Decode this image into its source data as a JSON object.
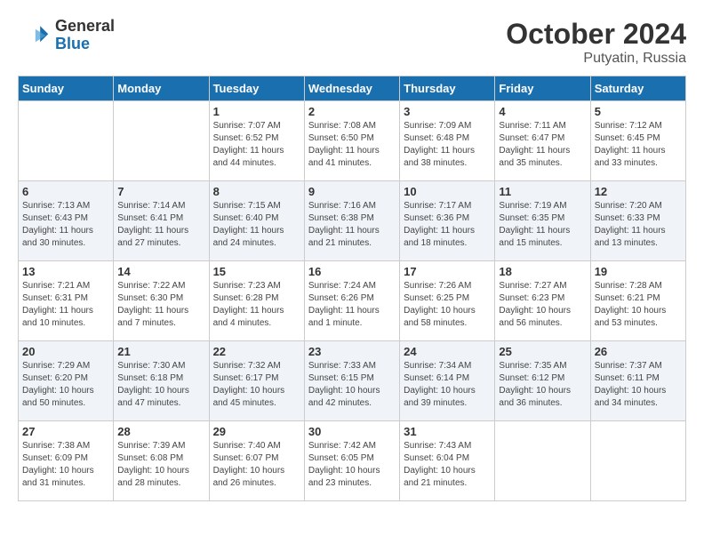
{
  "header": {
    "logo_line1": "General",
    "logo_line2": "Blue",
    "month": "October 2024",
    "location": "Putyatin, Russia"
  },
  "weekdays": [
    "Sunday",
    "Monday",
    "Tuesday",
    "Wednesday",
    "Thursday",
    "Friday",
    "Saturday"
  ],
  "weeks": [
    [
      {
        "day": "",
        "info": ""
      },
      {
        "day": "",
        "info": ""
      },
      {
        "day": "1",
        "info": "Sunrise: 7:07 AM\nSunset: 6:52 PM\nDaylight: 11 hours and 44 minutes."
      },
      {
        "day": "2",
        "info": "Sunrise: 7:08 AM\nSunset: 6:50 PM\nDaylight: 11 hours and 41 minutes."
      },
      {
        "day": "3",
        "info": "Sunrise: 7:09 AM\nSunset: 6:48 PM\nDaylight: 11 hours and 38 minutes."
      },
      {
        "day": "4",
        "info": "Sunrise: 7:11 AM\nSunset: 6:47 PM\nDaylight: 11 hours and 35 minutes."
      },
      {
        "day": "5",
        "info": "Sunrise: 7:12 AM\nSunset: 6:45 PM\nDaylight: 11 hours and 33 minutes."
      }
    ],
    [
      {
        "day": "6",
        "info": "Sunrise: 7:13 AM\nSunset: 6:43 PM\nDaylight: 11 hours and 30 minutes."
      },
      {
        "day": "7",
        "info": "Sunrise: 7:14 AM\nSunset: 6:41 PM\nDaylight: 11 hours and 27 minutes."
      },
      {
        "day": "8",
        "info": "Sunrise: 7:15 AM\nSunset: 6:40 PM\nDaylight: 11 hours and 24 minutes."
      },
      {
        "day": "9",
        "info": "Sunrise: 7:16 AM\nSunset: 6:38 PM\nDaylight: 11 hours and 21 minutes."
      },
      {
        "day": "10",
        "info": "Sunrise: 7:17 AM\nSunset: 6:36 PM\nDaylight: 11 hours and 18 minutes."
      },
      {
        "day": "11",
        "info": "Sunrise: 7:19 AM\nSunset: 6:35 PM\nDaylight: 11 hours and 15 minutes."
      },
      {
        "day": "12",
        "info": "Sunrise: 7:20 AM\nSunset: 6:33 PM\nDaylight: 11 hours and 13 minutes."
      }
    ],
    [
      {
        "day": "13",
        "info": "Sunrise: 7:21 AM\nSunset: 6:31 PM\nDaylight: 11 hours and 10 minutes."
      },
      {
        "day": "14",
        "info": "Sunrise: 7:22 AM\nSunset: 6:30 PM\nDaylight: 11 hours and 7 minutes."
      },
      {
        "day": "15",
        "info": "Sunrise: 7:23 AM\nSunset: 6:28 PM\nDaylight: 11 hours and 4 minutes."
      },
      {
        "day": "16",
        "info": "Sunrise: 7:24 AM\nSunset: 6:26 PM\nDaylight: 11 hours and 1 minute."
      },
      {
        "day": "17",
        "info": "Sunrise: 7:26 AM\nSunset: 6:25 PM\nDaylight: 10 hours and 58 minutes."
      },
      {
        "day": "18",
        "info": "Sunrise: 7:27 AM\nSunset: 6:23 PM\nDaylight: 10 hours and 56 minutes."
      },
      {
        "day": "19",
        "info": "Sunrise: 7:28 AM\nSunset: 6:21 PM\nDaylight: 10 hours and 53 minutes."
      }
    ],
    [
      {
        "day": "20",
        "info": "Sunrise: 7:29 AM\nSunset: 6:20 PM\nDaylight: 10 hours and 50 minutes."
      },
      {
        "day": "21",
        "info": "Sunrise: 7:30 AM\nSunset: 6:18 PM\nDaylight: 10 hours and 47 minutes."
      },
      {
        "day": "22",
        "info": "Sunrise: 7:32 AM\nSunset: 6:17 PM\nDaylight: 10 hours and 45 minutes."
      },
      {
        "day": "23",
        "info": "Sunrise: 7:33 AM\nSunset: 6:15 PM\nDaylight: 10 hours and 42 minutes."
      },
      {
        "day": "24",
        "info": "Sunrise: 7:34 AM\nSunset: 6:14 PM\nDaylight: 10 hours and 39 minutes."
      },
      {
        "day": "25",
        "info": "Sunrise: 7:35 AM\nSunset: 6:12 PM\nDaylight: 10 hours and 36 minutes."
      },
      {
        "day": "26",
        "info": "Sunrise: 7:37 AM\nSunset: 6:11 PM\nDaylight: 10 hours and 34 minutes."
      }
    ],
    [
      {
        "day": "27",
        "info": "Sunrise: 7:38 AM\nSunset: 6:09 PM\nDaylight: 10 hours and 31 minutes."
      },
      {
        "day": "28",
        "info": "Sunrise: 7:39 AM\nSunset: 6:08 PM\nDaylight: 10 hours and 28 minutes."
      },
      {
        "day": "29",
        "info": "Sunrise: 7:40 AM\nSunset: 6:07 PM\nDaylight: 10 hours and 26 minutes."
      },
      {
        "day": "30",
        "info": "Sunrise: 7:42 AM\nSunset: 6:05 PM\nDaylight: 10 hours and 23 minutes."
      },
      {
        "day": "31",
        "info": "Sunrise: 7:43 AM\nSunset: 6:04 PM\nDaylight: 10 hours and 21 minutes."
      },
      {
        "day": "",
        "info": ""
      },
      {
        "day": "",
        "info": ""
      }
    ]
  ]
}
